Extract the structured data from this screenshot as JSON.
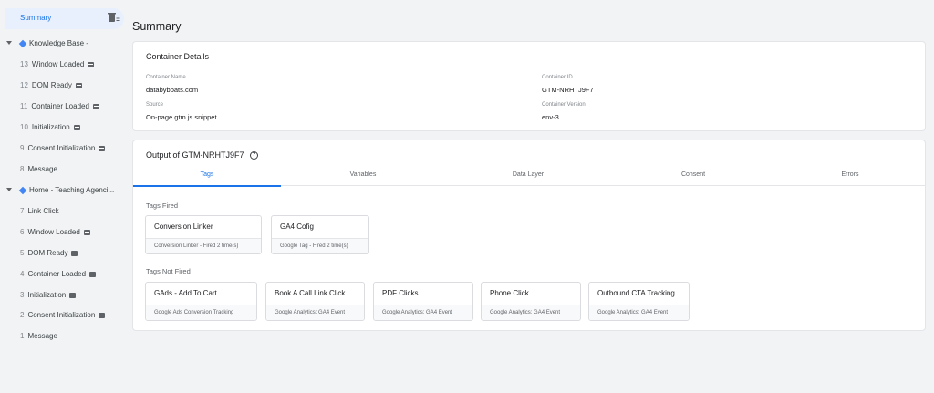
{
  "sidebar": {
    "summary_label": "Summary",
    "pages": [
      {
        "title": "Knowledge Base -",
        "events": [
          {
            "num": "13",
            "name": "Window Loaded"
          },
          {
            "num": "12",
            "name": "DOM Ready"
          },
          {
            "num": "11",
            "name": "Container Loaded"
          },
          {
            "num": "10",
            "name": "Initialization"
          },
          {
            "num": "9",
            "name": "Consent Initialization"
          },
          {
            "num": "8",
            "name": "Message"
          }
        ]
      },
      {
        "title": "Home - Teaching Agenci...",
        "events": [
          {
            "num": "7",
            "name": "Link Click"
          },
          {
            "num": "6",
            "name": "Window Loaded"
          },
          {
            "num": "5",
            "name": "DOM Ready"
          },
          {
            "num": "4",
            "name": "Container Loaded"
          },
          {
            "num": "3",
            "name": "Initialization"
          },
          {
            "num": "2",
            "name": "Consent Initialization"
          },
          {
            "num": "1",
            "name": "Message"
          }
        ]
      }
    ]
  },
  "main": {
    "title": "Summary",
    "container_details": {
      "title": "Container Details",
      "name_label": "Container Name",
      "name_value": "databyboats.com",
      "id_label": "Container ID",
      "id_value": "GTM-NRHTJ9F7",
      "source_label": "Source",
      "source_value": "On-page gtm.js snippet",
      "version_label": "Container Version",
      "version_value": "env-3"
    },
    "output": {
      "title": "Output of GTM-NRHTJ9F7",
      "help_glyph": "?",
      "tabs": [
        "Tags",
        "Variables",
        "Data Layer",
        "Consent",
        "Errors"
      ],
      "active_tab": "Tags",
      "fired_label": "Tags Fired",
      "fired": [
        {
          "name": "Conversion Linker",
          "sub": "Conversion Linker - Fired 2 time(s)"
        },
        {
          "name": "GA4 Cofig",
          "sub": "Google Tag - Fired 2 time(s)"
        }
      ],
      "not_fired_label": "Tags Not Fired",
      "not_fired": [
        {
          "name": "GAds - Add To Cart",
          "sub": "Google Ads Conversion Tracking"
        },
        {
          "name": "Book A Call Link Click",
          "sub": "Google Analytics: GA4 Event"
        },
        {
          "name": "PDF Clicks",
          "sub": "Google Analytics: GA4 Event"
        },
        {
          "name": "Phone Click",
          "sub": "Google Analytics: GA4 Event"
        },
        {
          "name": "Outbound CTA Tracking",
          "sub": "Google Analytics: GA4 Event"
        }
      ]
    }
  },
  "colors": {
    "accent": "#1a73e8",
    "page_diamond": "#4285f4",
    "background": "#f1f3f4"
  },
  "icons": {
    "summary_action": "delete-list-icon",
    "page_expand": "caret-down-icon",
    "page_marker": "diamond-icon",
    "event_badge": "event-badge-icon",
    "help": "help-circle-icon"
  }
}
